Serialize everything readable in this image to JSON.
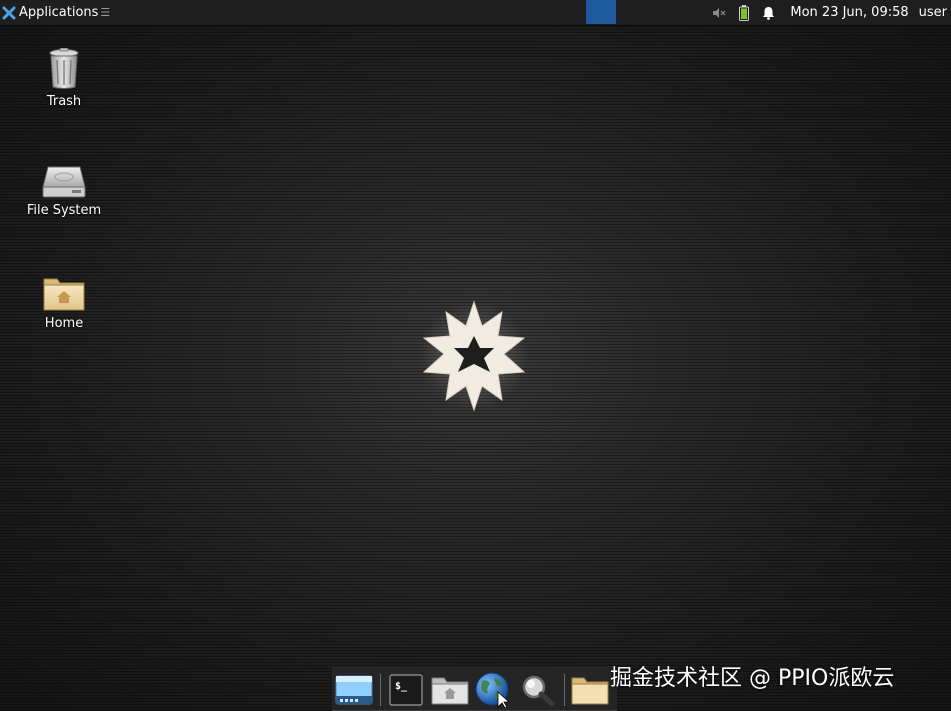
{
  "top_panel": {
    "applications_label": "Applications",
    "applications_separator": "☰",
    "clock": "Mon 23 Jun, 09:58",
    "user": "user"
  },
  "desktop": {
    "icons": [
      {
        "label": "Trash",
        "icon": "trash-icon"
      },
      {
        "label": "File System",
        "icon": "drive-icon"
      },
      {
        "label": "Home",
        "icon": "home-folder-icon"
      }
    ]
  },
  "dock": {
    "items": [
      {
        "icon": "show-desktop-icon"
      },
      {
        "icon": "terminal-icon"
      },
      {
        "icon": "file-manager-icon"
      },
      {
        "icon": "web-browser-icon"
      },
      {
        "icon": "app-finder-icon"
      },
      {
        "icon": "folder-icon"
      }
    ]
  },
  "watermark": "掘金技术社区 @ PPIO派欧云",
  "colors": {
    "panel_bg": "#1e1e1e",
    "workspace_active": "#1f5a9e",
    "dock_bg": "#252525"
  }
}
